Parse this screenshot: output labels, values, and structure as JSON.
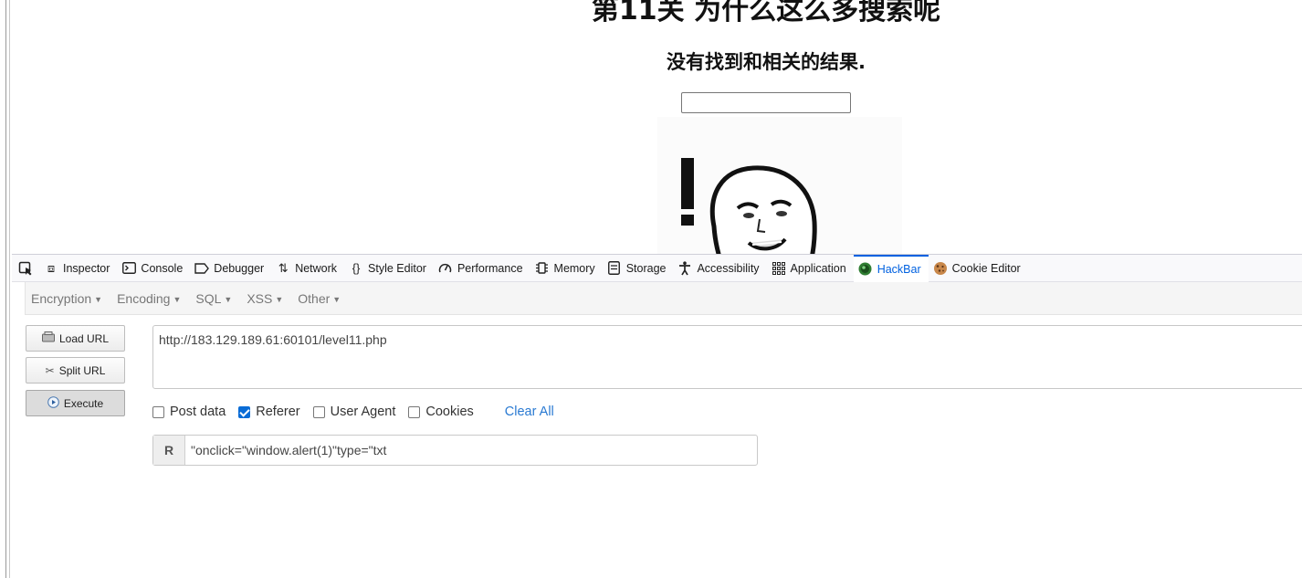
{
  "page": {
    "title": "第11关 为什么这么多搜索呢",
    "result_text": "没有找到和相关的结果.",
    "search_value": ""
  },
  "devtools": {
    "tabs": [
      {
        "label": "Inspector",
        "icon": "inspector-icon"
      },
      {
        "label": "Console",
        "icon": "console-icon"
      },
      {
        "label": "Debugger",
        "icon": "debugger-icon"
      },
      {
        "label": "Network",
        "icon": "network-icon"
      },
      {
        "label": "Style Editor",
        "icon": "style-editor-icon"
      },
      {
        "label": "Performance",
        "icon": "performance-icon"
      },
      {
        "label": "Memory",
        "icon": "memory-icon"
      },
      {
        "label": "Storage",
        "icon": "storage-icon"
      },
      {
        "label": "Accessibility",
        "icon": "accessibility-icon"
      },
      {
        "label": "Application",
        "icon": "application-icon"
      },
      {
        "label": "HackBar",
        "icon": "hackbar-icon"
      },
      {
        "label": "Cookie Editor",
        "icon": "cookie-icon"
      }
    ],
    "active_tab": "HackBar",
    "accent_color": "#0061e0"
  },
  "hackbar": {
    "menus": [
      "Encryption",
      "Encoding",
      "SQL",
      "XSS",
      "Other"
    ],
    "buttons": {
      "load_url": "Load URL",
      "split_url": "Split URL",
      "execute": "Execute"
    },
    "url": "http://183.129.189.61:60101/level11.php",
    "options": {
      "post_data": "Post data",
      "referer": "Referer",
      "user_agent": "User Agent",
      "cookies": "Cookies",
      "clear_all": "Clear All"
    },
    "checked": {
      "post_data": false,
      "referer": true,
      "user_agent": false,
      "cookies": false
    },
    "referer_label": "R",
    "referer_value": "\"onclick=\"window.alert(1)\"type=\"txt"
  }
}
